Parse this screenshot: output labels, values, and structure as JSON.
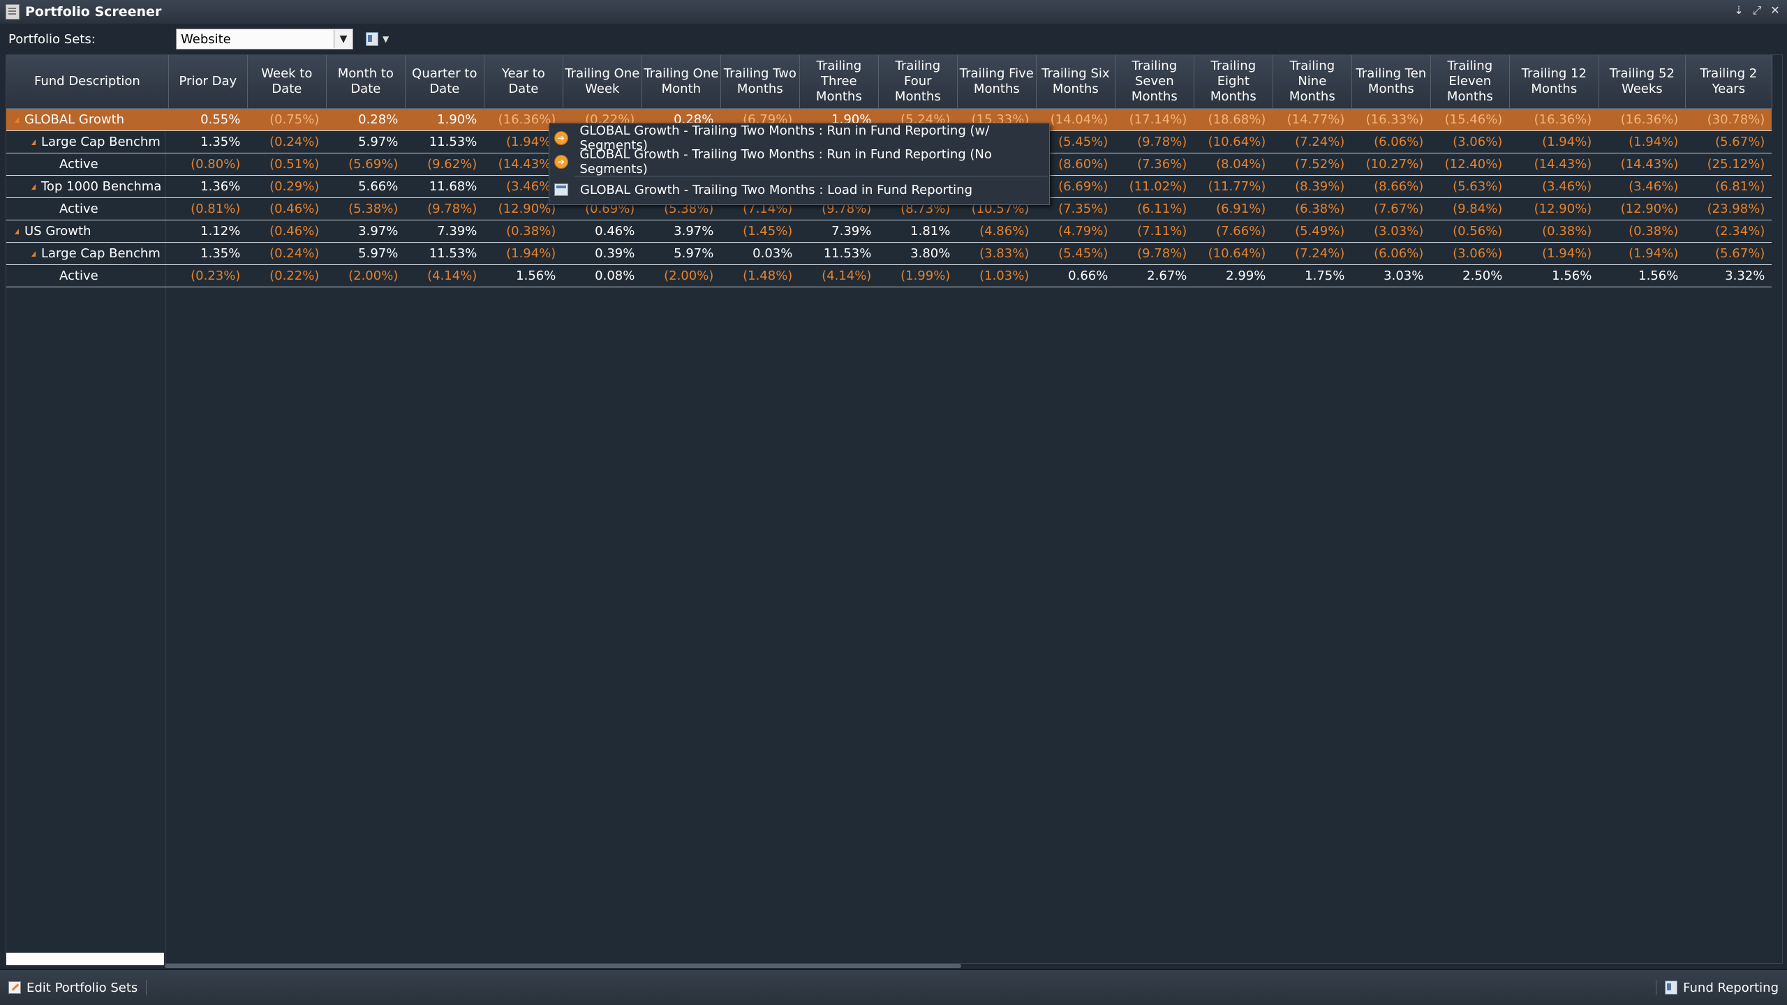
{
  "window": {
    "title": "Portfolio Screener",
    "controls": [
      "pin",
      "restore",
      "close"
    ]
  },
  "toolbar": {
    "portfolio_sets_label": "Portfolio Sets:",
    "portfolio_set_value": "Website"
  },
  "grid": {
    "columns": [
      "Fund Description",
      "Prior Day",
      "Week to Date",
      "Month to Date",
      "Quarter to Date",
      "Year to Date",
      "Trailing One Week",
      "Trailing One Month",
      "Trailing Two Months",
      "Trailing Three Months",
      "Trailing Four Months",
      "Trailing Five Months",
      "Trailing Six Months",
      "Trailing Seven Months",
      "Trailing Eight Months",
      "Trailing Nine Months",
      "Trailing Ten Months",
      "Trailing Eleven Months",
      "Trailing 12 Months",
      "Trailing 52 Weeks",
      "Trailing 2 Years"
    ],
    "rows": [
      {
        "desc": "GLOBAL Growth",
        "level": 0,
        "expandable": true,
        "selected": true,
        "values": [
          "0.55%",
          "(0.75%)",
          "0.28%",
          "1.90%",
          "(16.36%)",
          "(0.22%)",
          "0.28%",
          "(6.79%)",
          "1.90%",
          "(5.24%)",
          "(15.33%)",
          "(14.04%)",
          "(17.14%)",
          "(18.68%)",
          "(14.77%)",
          "(16.33%)",
          "(15.46%)",
          "(16.36%)",
          "(16.36%)",
          "(30.78%)"
        ]
      },
      {
        "desc": "Large Cap Benchm",
        "level": 1,
        "expandable": true,
        "selected": false,
        "values": [
          "1.35%",
          "(0.24%)",
          "5.97%",
          "11.53%",
          "(1.94%)",
          "",
          "",
          "",
          "",
          "",
          "",
          "(5.45%)",
          "(9.78%)",
          "(10.64%)",
          "(7.24%)",
          "(6.06%)",
          "(3.06%)",
          "(1.94%)",
          "(1.94%)",
          "(5.67%)"
        ]
      },
      {
        "desc": "Active",
        "level": 2,
        "expandable": false,
        "selected": false,
        "values": [
          "(0.80%)",
          "(0.51%)",
          "(5.69%)",
          "(9.62%)",
          "(14.43%)",
          "",
          "",
          "",
          "",
          "",
          "",
          "(8.60%)",
          "(7.36%)",
          "(8.04%)",
          "(7.52%)",
          "(10.27%)",
          "(12.40%)",
          "(14.43%)",
          "(14.43%)",
          "(25.12%)"
        ]
      },
      {
        "desc": "Top 1000 Benchma",
        "level": 1,
        "expandable": true,
        "selected": false,
        "values": [
          "1.36%",
          "(0.29%)",
          "5.66%",
          "11.68%",
          "(3.46%)",
          "",
          "",
          "",
          "",
          "",
          "",
          "(6.69%)",
          "(11.02%)",
          "(11.77%)",
          "(8.39%)",
          "(8.66%)",
          "(5.63%)",
          "(3.46%)",
          "(3.46%)",
          "(6.81%)"
        ]
      },
      {
        "desc": "Active",
        "level": 2,
        "expandable": false,
        "selected": false,
        "values": [
          "(0.81%)",
          "(0.46%)",
          "(5.38%)",
          "(9.78%)",
          "(12.90%)",
          "(0.69%)",
          "(5.38%)",
          "(7.14%)",
          "(9.78%)",
          "(8.73%)",
          "(10.57%)",
          "(7.35%)",
          "(6.11%)",
          "(6.91%)",
          "(6.38%)",
          "(7.67%)",
          "(9.84%)",
          "(12.90%)",
          "(12.90%)",
          "(23.98%)"
        ]
      },
      {
        "desc": "US Growth",
        "level": 0,
        "expandable": true,
        "selected": false,
        "values": [
          "1.12%",
          "(0.46%)",
          "3.97%",
          "7.39%",
          "(0.38%)",
          "0.46%",
          "3.97%",
          "(1.45%)",
          "7.39%",
          "1.81%",
          "(4.86%)",
          "(4.79%)",
          "(7.11%)",
          "(7.66%)",
          "(5.49%)",
          "(3.03%)",
          "(0.56%)",
          "(0.38%)",
          "(0.38%)",
          "(2.34%)"
        ]
      },
      {
        "desc": "Large Cap Benchm",
        "level": 1,
        "expandable": true,
        "selected": false,
        "values": [
          "1.35%",
          "(0.24%)",
          "5.97%",
          "11.53%",
          "(1.94%)",
          "0.39%",
          "5.97%",
          "0.03%",
          "11.53%",
          "3.80%",
          "(3.83%)",
          "(5.45%)",
          "(9.78%)",
          "(10.64%)",
          "(7.24%)",
          "(6.06%)",
          "(3.06%)",
          "(1.94%)",
          "(1.94%)",
          "(5.67%)"
        ]
      },
      {
        "desc": "Active",
        "level": 2,
        "expandable": false,
        "selected": false,
        "values": [
          "(0.23%)",
          "(0.22%)",
          "(2.00%)",
          "(4.14%)",
          "1.56%",
          "0.08%",
          "(2.00%)",
          "(1.48%)",
          "(4.14%)",
          "(1.99%)",
          "(1.03%)",
          "0.66%",
          "2.67%",
          "2.99%",
          "1.75%",
          "3.03%",
          "2.50%",
          "1.56%",
          "1.56%",
          "3.32%"
        ]
      }
    ]
  },
  "context_menu": {
    "items": [
      {
        "label": "GLOBAL Growth - Trailing Two Months : Run in Fund Reporting (w/ Segments)",
        "icon": "run-icon"
      },
      {
        "label": "GLOBAL Growth - Trailing Two Months : Run in Fund Reporting (No Segments)",
        "icon": "run-icon"
      },
      {
        "label": "GLOBAL Growth - Trailing Two Months : Load in Fund Reporting",
        "icon": "load-icon"
      }
    ]
  },
  "statusbar": {
    "edit_label": "Edit Portfolio Sets",
    "fund_reporting_label": "Fund Reporting"
  },
  "colors": {
    "background": "#1f2833",
    "negative": "#e6822c",
    "selected_row": "#b8662a",
    "text": "#ffffff"
  }
}
